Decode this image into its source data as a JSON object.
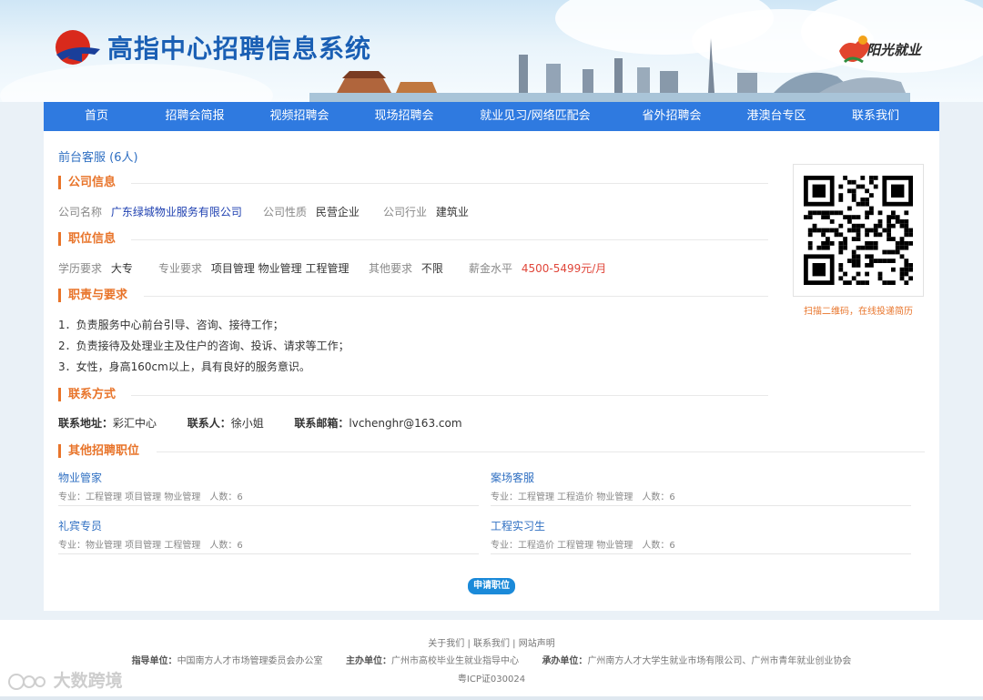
{
  "header": {
    "site_title": "高指中心招聘信息系统",
    "brand": "阳光就业"
  },
  "nav": [
    "首页",
    "招聘会简报",
    "视频招聘会",
    "现场招聘会",
    "就业见习/网络匹配会",
    "省外招聘会",
    "港澳台专区",
    "联系我们"
  ],
  "job": {
    "title": "前台客服 (6人)"
  },
  "company": {
    "section": "公司信息",
    "name_label": "公司名称",
    "name": "广东绿城物业服务有限公司",
    "type_label": "公司性质",
    "type": "民营企业",
    "industry_label": "公司行业",
    "industry": "建筑业"
  },
  "position": {
    "section": "职位信息",
    "edu_label": "学历要求",
    "edu": "大专",
    "major_label": "专业要求",
    "major": "项目管理 物业管理 工程管理",
    "other_label": "其他要求",
    "other": "不限",
    "salary_label": "薪金水平",
    "salary": "4500-5499元/月"
  },
  "duties": {
    "section": "职责与要求",
    "lines": [
      "1．负责服务中心前台引导、咨询、接待工作；",
      "2．负责接待及处理业主及住户的咨询、投诉、请求等工作；",
      "3．女性，身高160cm以上，具有良好的服务意识。"
    ]
  },
  "contact": {
    "section": "联系方式",
    "address_label": "联系地址：",
    "address": "彩汇中心",
    "person_label": "联系人：",
    "person": "徐小姐",
    "email_label": "联系邮箱：",
    "email": "lvchenghr@163.com"
  },
  "qr": {
    "caption": "扫描二维码，在线投递简历"
  },
  "other_jobs": {
    "section": "其他招聘职位",
    "items": [
      {
        "name": "物业管家",
        "meta": "专业：工程管理 项目管理 物业管理　人数：6"
      },
      {
        "name": "案场客服",
        "meta": "专业：工程管理 工程造价 物业管理　人数：6"
      },
      {
        "name": "礼宾专员",
        "meta": "专业：物业管理 项目管理 工程管理　人数：6"
      },
      {
        "name": "工程实习生",
        "meta": "专业：工程造价 工程管理 物业管理　人数：6"
      }
    ]
  },
  "apply_label": "申请职位",
  "footer": {
    "links": [
      "关于我们",
      "联系我们",
      "网站声明"
    ],
    "guide_label": "指导单位：",
    "guide": "中国南方人才市场管理委员会办公室",
    "host_label": "主办单位：",
    "host": "广州市高校毕业生就业指导中心",
    "organizer_label": "承办单位：",
    "organizer": "广州南方人才大学生就业市场有限公司、广州市青年就业创业协会",
    "icp": "粤ICP证030024"
  },
  "watermark": "大数跨境",
  "colors": {
    "nav": "#2f7ae0",
    "accent": "#e8742a",
    "link": "#2f6fc2",
    "salary": "#e0463a"
  }
}
